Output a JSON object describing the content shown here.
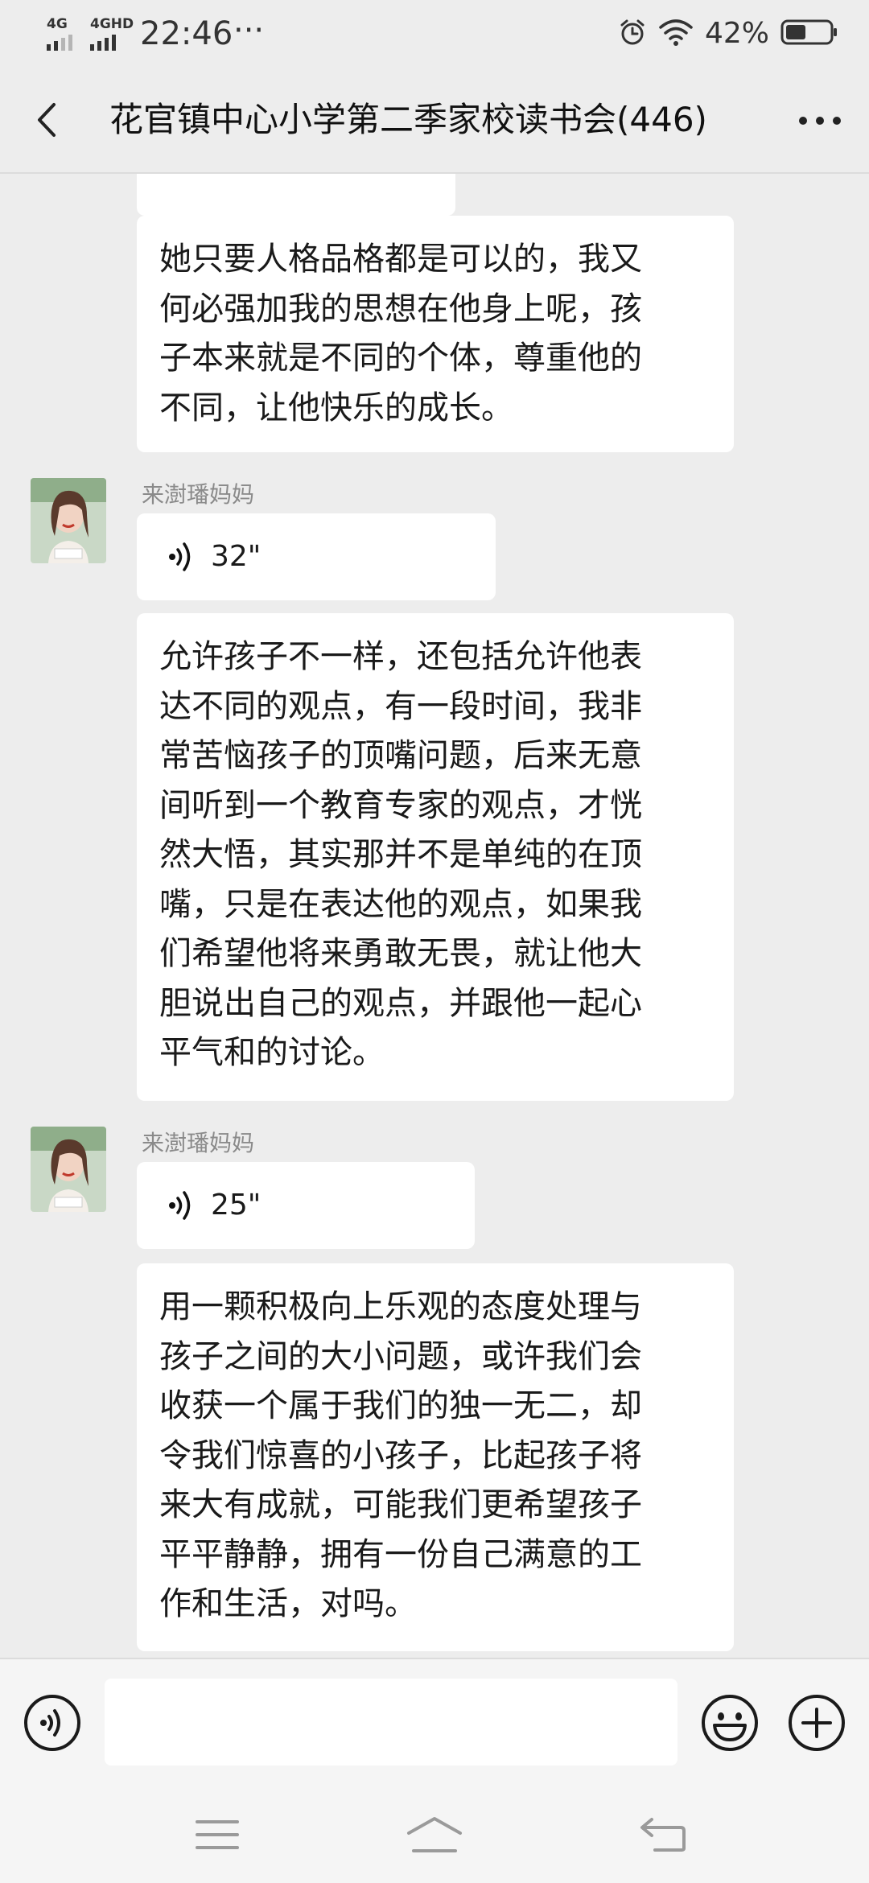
{
  "status_bar": {
    "network_1": "4G",
    "network_2": "4GHD",
    "time": "22:46",
    "more_indicator": "···",
    "battery_percent": "42%",
    "icons": [
      "alarm-icon",
      "wifi-icon",
      "battery-icon"
    ]
  },
  "header": {
    "title": "花官镇中心小学第二季家校读书会(446)",
    "back_icon": "chevron-left-icon",
    "more_icon": "more-dots-icon"
  },
  "messages": [
    {
      "type": "text",
      "text": "她只要人格品格都是可以的，我又\n何必强加我的思想在他身上呢，孩\n子本来就是不同的个体，尊重他的\n不同，让他快乐的成长。"
    },
    {
      "type": "voice",
      "sender": "来澍璠妈妈",
      "duration": "32\""
    },
    {
      "type": "text",
      "text": "允许孩子不一样，还包括允许他表\n达不同的观点，有一段时间，我非\n常苦恼孩子的顶嘴问题，后来无意\n间听到一个教育专家的观点，才恍\n然大悟，其实那并不是单纯的在顶\n嘴，只是在表达他的观点，如果我\n们希望他将来勇敢无畏，就让他大\n胆说出自己的观点，并跟他一起心\n平气和的讨论。"
    },
    {
      "type": "voice",
      "sender": "来澍璠妈妈",
      "duration": "25\""
    },
    {
      "type": "text",
      "text": "用一颗积极向上乐观的态度处理与\n孩子之间的大小问题，或许我们会\n收获一个属于我们的独一无二，却\n令我们惊喜的小孩子，比起孩子将\n来大有成就，可能我们更希望孩子\n平平静静，拥有一份自己满意的工\n作和生活，对吗。"
    }
  ],
  "input_bar": {
    "input_value": "",
    "icons": [
      "voice-toggle-icon",
      "emoji-icon",
      "plus-icon"
    ]
  },
  "nav_bar": {
    "icons": [
      "menu-icon",
      "home-icon",
      "back-icon"
    ]
  },
  "colors": {
    "background": "#ededed",
    "bubble": "#ffffff",
    "sender_name": "#8a8a8a",
    "text": "#1a1a1a"
  }
}
